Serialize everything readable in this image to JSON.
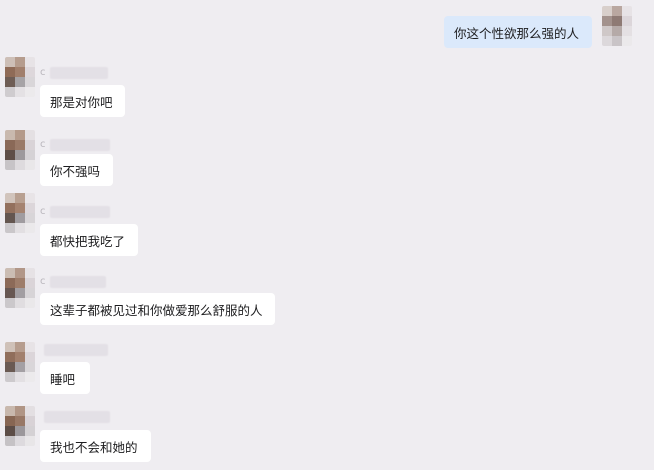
{
  "conversation": {
    "outgoing": {
      "text": "你这个性欲那么强的人"
    },
    "incoming": [
      {
        "name_initial": "c",
        "text": "那是对你吧"
      },
      {
        "name_initial": "c",
        "text": "你不强吗"
      },
      {
        "name_initial": "c",
        "text": "都快把我吃了"
      },
      {
        "name_initial": "c",
        "text": "这辈子都被见过和你做爱那么舒服的人"
      },
      {
        "name_initial": "",
        "text": "睡吧"
      },
      {
        "name_initial": "",
        "text": "我也不会和她的"
      }
    ]
  },
  "colors": {
    "background": "#efedf1",
    "incoming_bubble": "#ffffff",
    "outgoing_bubble": "#dbe9fb",
    "text": "#1d1d1f"
  }
}
